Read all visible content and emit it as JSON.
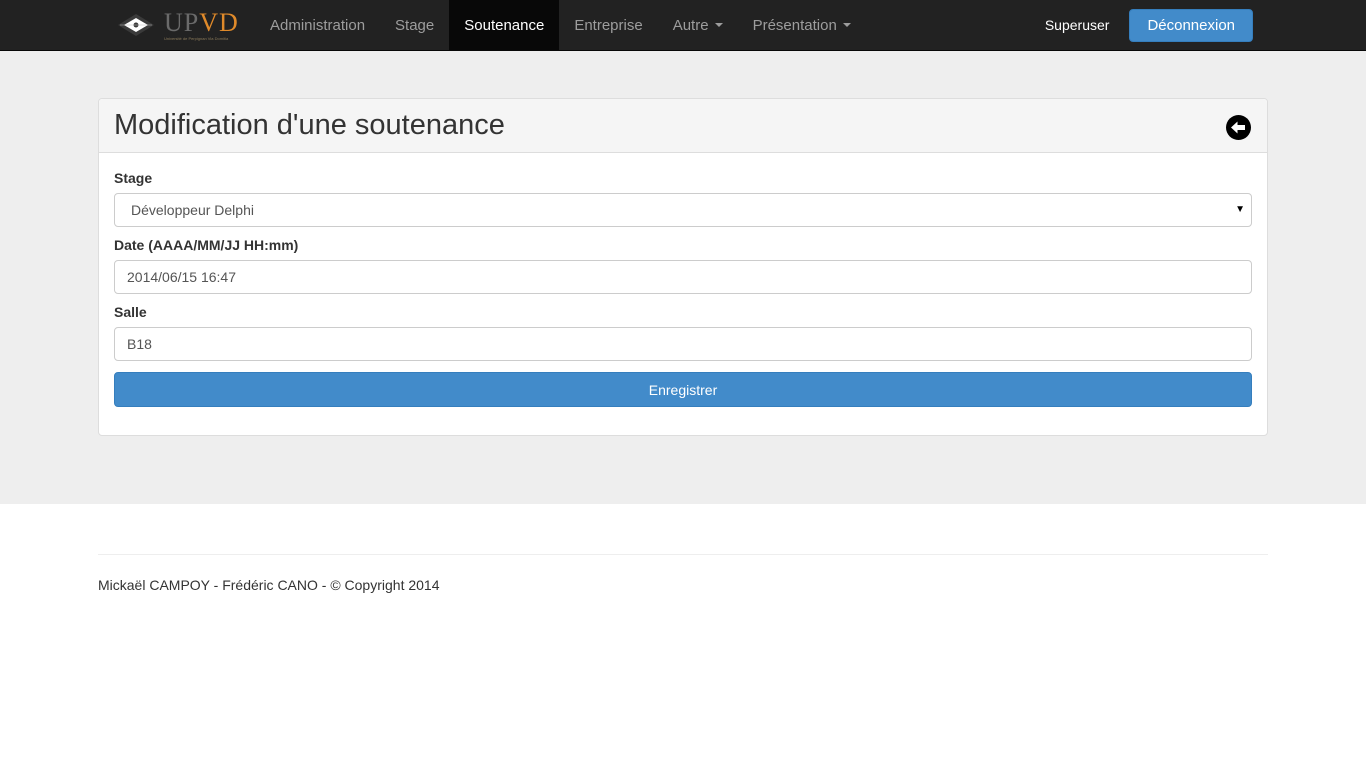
{
  "brand": {
    "letters_up": "UP",
    "letters_vd": "VD",
    "tagline": "Université de Perpignan Via Domitia"
  },
  "nav": {
    "items": [
      {
        "label": "Administration",
        "active": false,
        "dropdown": false
      },
      {
        "label": "Stage",
        "active": false,
        "dropdown": false
      },
      {
        "label": "Soutenance",
        "active": true,
        "dropdown": false
      },
      {
        "label": "Entreprise",
        "active": false,
        "dropdown": false
      },
      {
        "label": "Autre",
        "active": false,
        "dropdown": true
      },
      {
        "label": "Présentation",
        "active": false,
        "dropdown": true
      }
    ],
    "user": "Superuser",
    "logout_label": "Déconnexion"
  },
  "panel": {
    "title": "Modification d'une soutenance",
    "back_icon": "circle-arrow-left-icon"
  },
  "form": {
    "stage_label": "Stage",
    "stage_value": "Développeur Delphi",
    "date_label": "Date (AAAA/MM/JJ HH:mm)",
    "date_value": "2014/06/15 16:47",
    "salle_label": "Salle",
    "salle_value": "B18",
    "submit_label": "Enregistrer"
  },
  "footer": {
    "text": "Mickaël CAMPOY - Frédéric CANO - © Copyright 2014"
  },
  "colors": {
    "navbar": "#222222",
    "primary": "#428bca",
    "band": "#eeeeee",
    "brand_orange": "#e08a2a"
  }
}
